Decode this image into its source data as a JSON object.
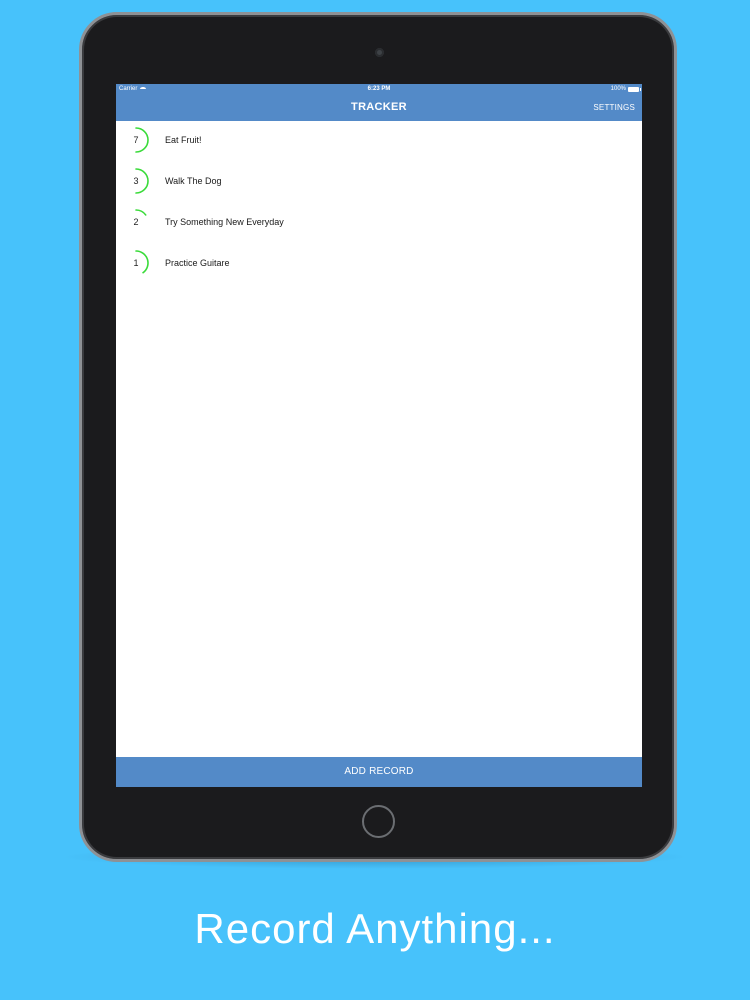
{
  "status_bar": {
    "carrier": "Carrier",
    "time": "6:23 PM",
    "battery": "100%"
  },
  "nav": {
    "title": "TRACKER",
    "settings": "SETTINGS"
  },
  "items": [
    {
      "count": "7",
      "label": "Eat Fruit!",
      "progress": 0.5
    },
    {
      "count": "3",
      "label": "Walk The Dog",
      "progress": 0.5
    },
    {
      "count": "2",
      "label": "Try Something New Everyday",
      "progress": 0.15
    },
    {
      "count": "1",
      "label": "Practice Guitare",
      "progress": 0.4
    }
  ],
  "footer": {
    "add_record": "ADD RECORD"
  },
  "caption": "Record Anything...",
  "colors": {
    "background": "#47c2fb",
    "nav_bar": "#538ac8",
    "progress_ring": "#3adb3a"
  },
  "icons": {
    "wifi": "wifi-icon",
    "battery": "battery-icon",
    "camera": "camera-icon",
    "home_button": "home-button-icon"
  }
}
